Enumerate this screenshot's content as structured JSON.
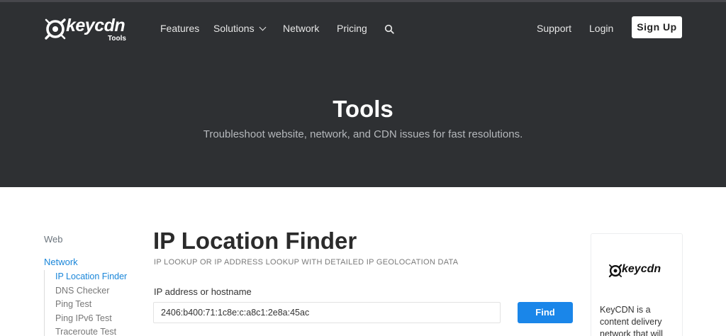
{
  "brand": {
    "name": "keycdn",
    "sub": "Tools"
  },
  "nav": {
    "features": "Features",
    "solutions": "Solutions",
    "network": "Network",
    "pricing": "Pricing",
    "support": "Support",
    "login": "Login",
    "signup": "Sign Up"
  },
  "hero": {
    "title": "Tools",
    "subtitle": "Troubleshoot website, network, and CDN issues for fast resolutions."
  },
  "sidebar": {
    "web": "Web",
    "network": "Network",
    "items": [
      {
        "label": "IP Location Finder"
      },
      {
        "label": "DNS Checker"
      },
      {
        "label": "Ping Test"
      },
      {
        "label": "Ping IPv6 Test"
      },
      {
        "label": "Traceroute Test"
      }
    ]
  },
  "main": {
    "title": "IP Location Finder",
    "subtitle": "IP LOOKUP OR IP ADDRESS LOOKUP WITH DETAILED IP GEOLOCATION DATA",
    "field_label": "IP address or hostname",
    "input_value": "2406:b400:71:1c8e:c:a8c1:2e8a:45ac",
    "find_label": "Find"
  },
  "ad": {
    "brand": "keycdn",
    "text": "KeyCDN is a content delivery network that will"
  },
  "colors": {
    "header_bg": "#2e3033",
    "accent": "#1a86e9",
    "active_link": "#1a86d9"
  },
  "icons": {
    "logo": "keycdn-key-icon",
    "search": "search-icon",
    "solutions_dropdown": "chevron-down-icon"
  }
}
